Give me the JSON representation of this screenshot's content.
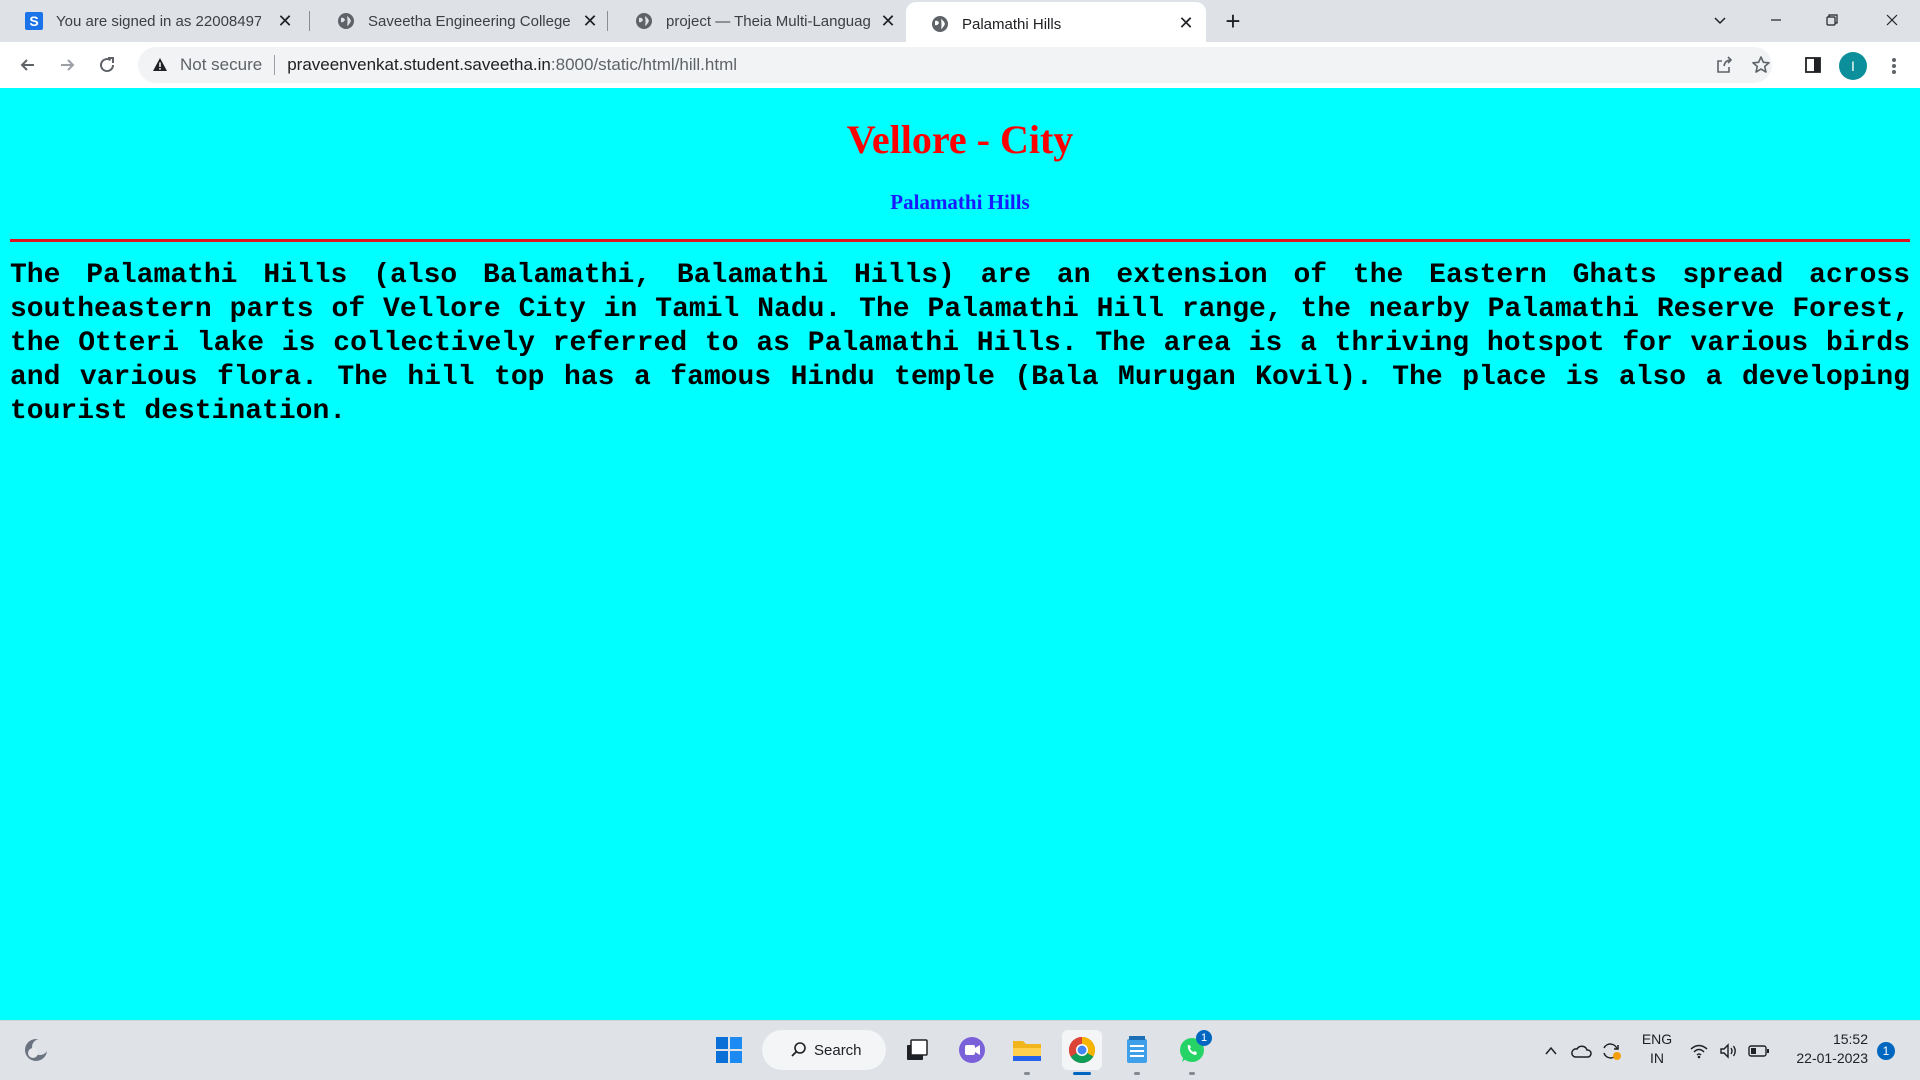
{
  "browser": {
    "tabs": [
      {
        "title": "You are signed in as 22008497",
        "icon": "saveetha-s-icon",
        "active": false
      },
      {
        "title": "Saveetha Engineering College",
        "icon": "globe-icon",
        "active": false
      },
      {
        "title": "project — Theia Multi-Language",
        "icon": "globe-icon",
        "active": false
      },
      {
        "title": "Palamathi Hills",
        "icon": "globe-icon",
        "active": true
      }
    ],
    "address": {
      "security_label": "Not secure",
      "host": "praveenvenkat.student.saveetha.in",
      "path": ":8000/static/html/hill.html"
    },
    "profile_initial": "I"
  },
  "page": {
    "heading": "Vellore - City",
    "subheading": "Palamathi Hills",
    "paragraph": "The Palamathi Hills (also Balamathi, Balamathi Hills) are an extension of the Eastern Ghats spread across southeastern parts of Vellore City in Tamil Nadu. The Palamathi Hill range, the nearby Palamathi Reserve Forest, the Otteri lake is collectively referred to as Palamathi Hills. The area is a thriving hotspot for various birds and various flora. The hill top has a famous Hindu temple (Bala Murugan Kovil). The place is also a developing tourist destination.",
    "colors": {
      "background": "#00ffff",
      "heading": "#ff0000",
      "subheading": "#1a1aff",
      "rule": "#e0141f"
    }
  },
  "taskbar": {
    "search_label": "Search",
    "whatsapp_badge": "1",
    "language": {
      "line1": "ENG",
      "line2": "IN"
    },
    "time": "15:52",
    "date": "22-01-2023",
    "notification_count": "1"
  }
}
